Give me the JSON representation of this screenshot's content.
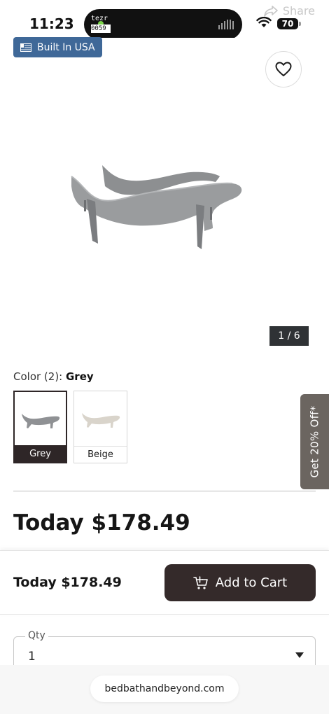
{
  "status_bar": {
    "time": "11:23",
    "battery": "70",
    "island_app_top": "tezr",
    "island_app_bottom": "0059"
  },
  "share": {
    "label": "Share",
    "icon": "share-icon"
  },
  "product": {
    "badge": "Built In USA",
    "badge_color": "#3f6898",
    "image_counter": "1 / 6",
    "favorite_icon": "heart-icon"
  },
  "color": {
    "label_prefix": "Color (2): ",
    "selected": "Grey",
    "options": [
      {
        "name": "Grey",
        "selected": true
      },
      {
        "name": "Beige",
        "selected": false
      }
    ]
  },
  "promo": {
    "label": "Get 20% Off*",
    "color": "#6b6560"
  },
  "price": {
    "today": "Today $178.49"
  },
  "sticky_cart": {
    "price": "Today $178.49",
    "button_label": "Add to Cart",
    "button_icon": "cart-plus-icon",
    "button_color": "#342a2a"
  },
  "qty": {
    "label": "Qty",
    "value": "1"
  },
  "browser": {
    "url": "bedbathandbeyond.com"
  }
}
